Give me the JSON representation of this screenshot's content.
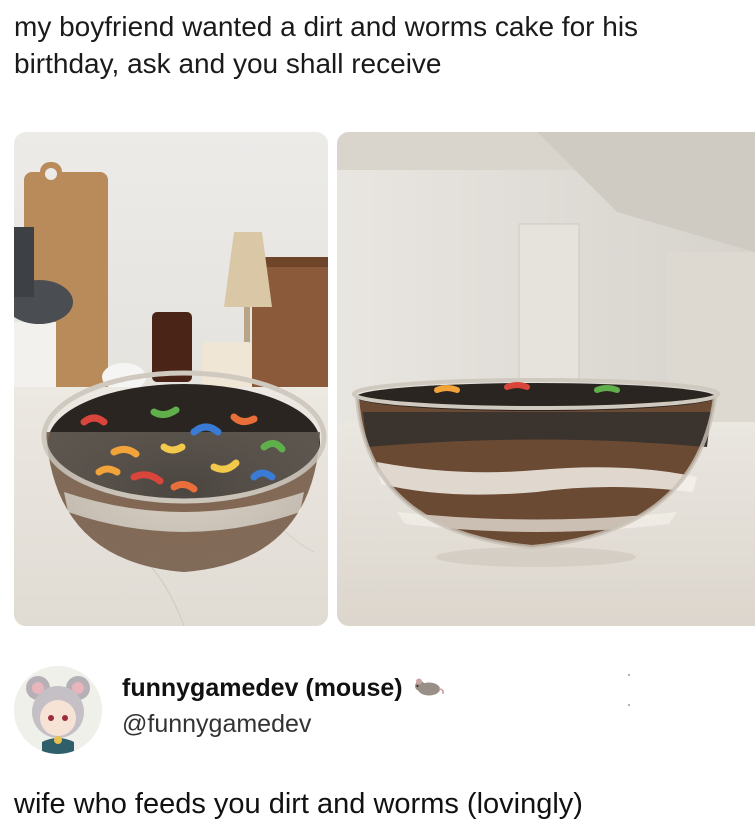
{
  "post": {
    "caption": "my boyfriend wanted a dirt and worms cake for his birthday, ask and you shall receive"
  },
  "photos": [
    {
      "subject": "left-photo"
    },
    {
      "subject": "right-photo"
    }
  ],
  "author": {
    "display_name": "funnygamedev (mouse)",
    "handle": "@funnygamedev",
    "name_emoji": "mouse-icon"
  },
  "reply": {
    "text": "wife who feeds you dirt and worms (lovingly)"
  },
  "colors": {
    "text": "#111111",
    "handle": "#333333",
    "background": "#ffffff",
    "dirt": "#2b2521",
    "pudding": "#6b4a33",
    "cream": "#f4f1ea"
  }
}
